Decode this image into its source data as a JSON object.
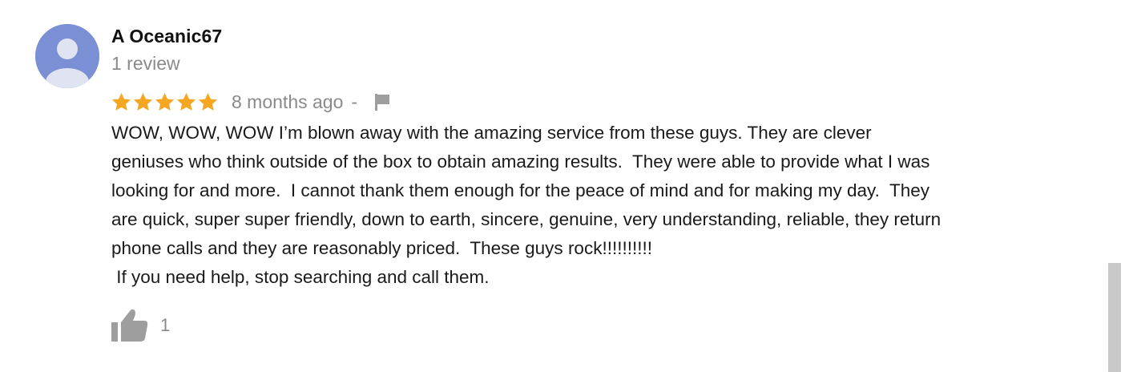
{
  "review": {
    "author": "A Oceanic67",
    "review_count": "1 review",
    "rating": 5,
    "rating_max": 5,
    "time_ago": "8 months ago",
    "separator": "-",
    "body_lines": [
      "WOW, WOW, WOW I’m blown away with the amazing service from these guys. They are clever",
      "geniuses who think outside of the box to obtain amazing results.  They were able to provide what I was",
      "looking for and more.  I cannot thank them enough for the peace of mind and for making my day.  They",
      "are quick, super super friendly, down to earth, sincere, genuine, very understanding, reliable, they return",
      "phone calls and they are reasonably priced.  These guys rock!!!!!!!!!!",
      " If you need help, stop searching and call them."
    ],
    "like_count": "1"
  },
  "icons": {
    "avatar": "default-avatar-icon",
    "star": "star-icon",
    "flag": "flag-icon",
    "like": "thumbs-up-icon"
  },
  "colors": {
    "avatar_bg": "#7b8fd4",
    "star": "#f5a623",
    "muted": "#8a8a8a",
    "icon_gray": "#9e9e9e"
  }
}
